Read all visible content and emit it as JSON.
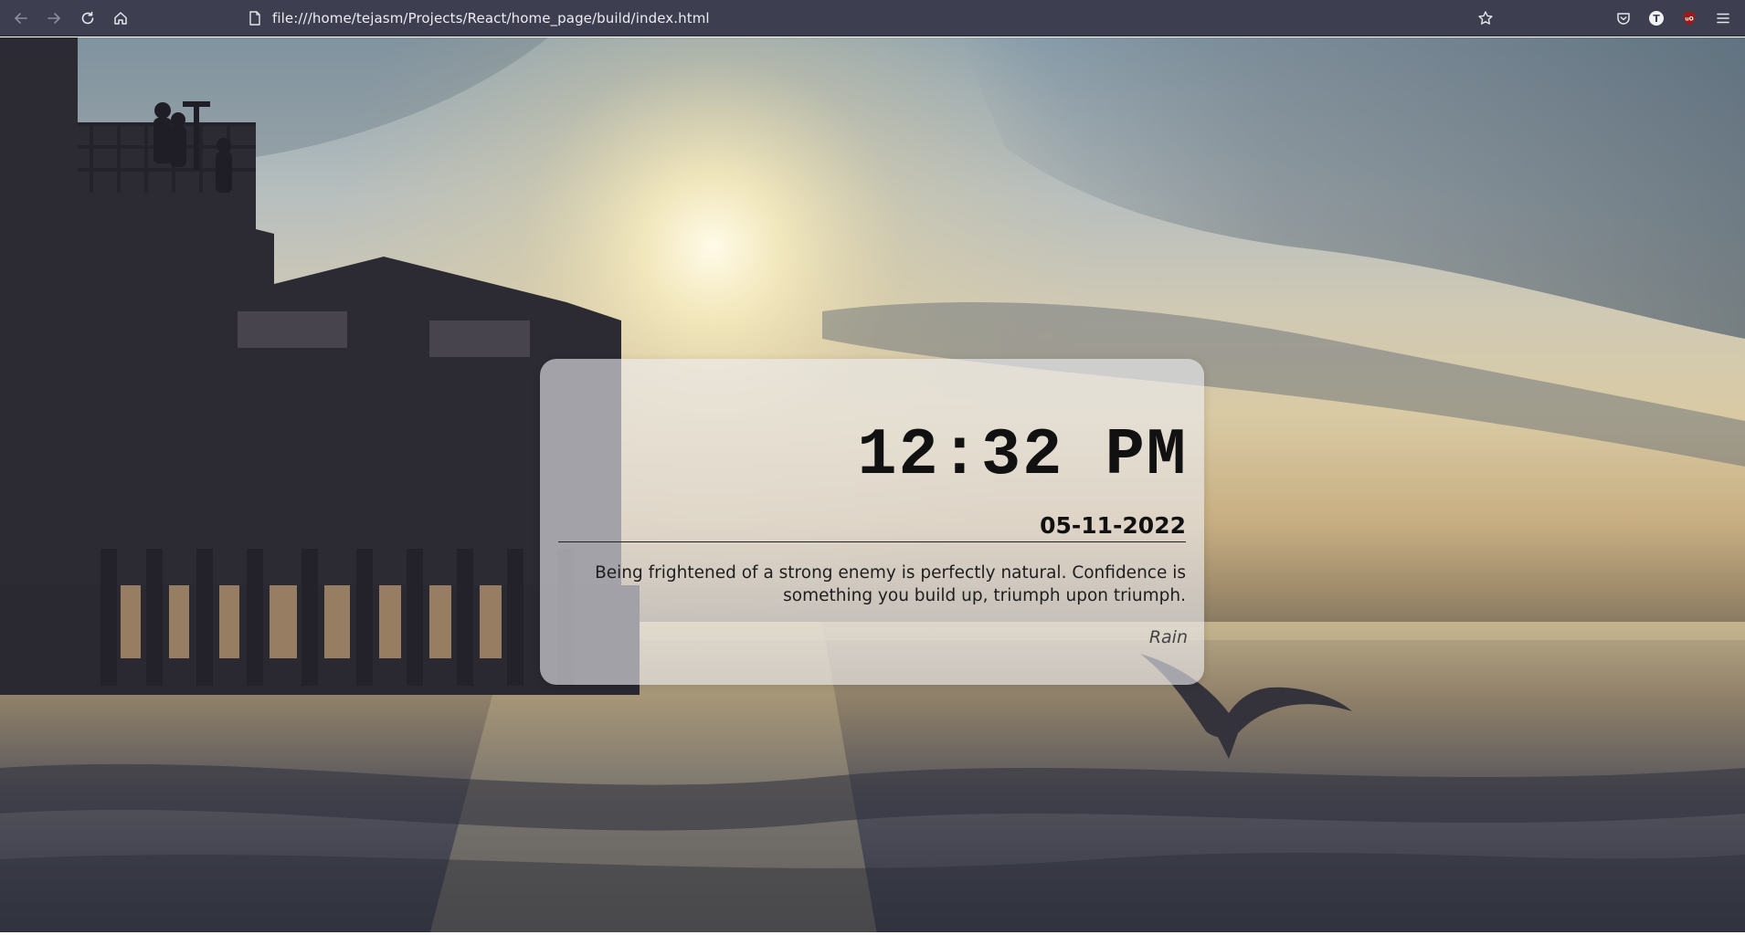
{
  "browser": {
    "url": "file:///home/tejasm/Projects/React/home_page/build/index.html",
    "icons": {
      "back": "back-arrow-icon",
      "forward": "forward-arrow-icon",
      "reload": "reload-icon",
      "home": "home-icon",
      "page": "page-icon",
      "bookmark": "star-icon",
      "pocket": "pocket-icon",
      "extension": "extension-t-icon",
      "ublock": "ublock-icon",
      "menu": "hamburger-menu-icon"
    },
    "ublock_label": "uO",
    "extension_label": "T"
  },
  "widget": {
    "time": "12:32 PM",
    "date": "05-11-2022",
    "quote": "Being frightened of a strong enemy is perfectly natural. Confidence is something you build up, triumph upon triumph.",
    "author": "Rain"
  },
  "colors": {
    "toolbar": "#3d3f50",
    "card": "#ebebf0",
    "text": "#111111"
  }
}
